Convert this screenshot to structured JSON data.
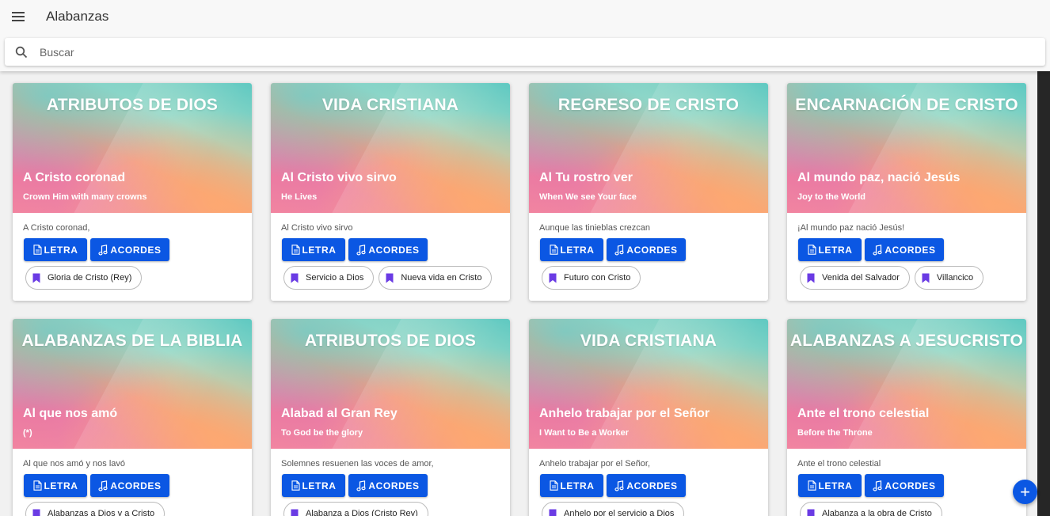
{
  "app": {
    "title": "Alabanzas"
  },
  "search": {
    "placeholder": "Buscar"
  },
  "colors": {
    "primary": "#0b57e3"
  },
  "buttons": {
    "letra": "LETRA",
    "acordes": "ACORDES"
  },
  "cards": [
    {
      "category": "ATRIBUTOS DE DIOS",
      "title": "A Cristo coronad",
      "subtitle": "Crown Him with many crowns",
      "first_line": "A Cristo coronad,",
      "tags": [
        "Gloria de Cristo (Rey)"
      ]
    },
    {
      "category": "VIDA CRISTIANA",
      "title": "Al Cristo vivo sirvo",
      "subtitle": "He Lives",
      "first_line": "Al Cristo vivo sirvo",
      "tags": [
        "Servicio a Dios",
        "Nueva vida en Cristo"
      ]
    },
    {
      "category": "REGRESO DE CRISTO",
      "title": "Al Tu rostro ver",
      "subtitle": "When We see Your face",
      "first_line": "Aunque las tinieblas crezcan",
      "tags": [
        "Futuro con Cristo"
      ]
    },
    {
      "category": "ENCARNACIÓN DE CRISTO",
      "title": "Al mundo paz, nació Jesús",
      "subtitle": "Joy to the World",
      "first_line": "¡Al mundo paz nació Jesús!",
      "tags": [
        "Venida del Salvador",
        "Villancico"
      ]
    },
    {
      "category": "ALABANZAS DE LA BIBLIA",
      "title": "Al que nos amó",
      "subtitle": "(*)",
      "first_line": "Al que nos amó y nos lavó",
      "tags": [
        "Alabanzas a Dios y a Cristo"
      ]
    },
    {
      "category": "ATRIBUTOS DE DIOS",
      "title": "Alabad al Gran Rey",
      "subtitle": "To God be the glory",
      "first_line": "Solemnes resuenen las voces de amor,",
      "tags": [
        "Alabanza a Dios (Cristo Rey)"
      ]
    },
    {
      "category": "VIDA CRISTIANA",
      "title": "Anhelo trabajar por el Señor",
      "subtitle": "I Want to Be a Worker",
      "first_line": "Anhelo trabajar por el Señor,",
      "tags": [
        "Anhelo por el servicio a Dios"
      ]
    },
    {
      "category": "ALABANZAS A JESUCRISTO",
      "title": "Ante el trono celestial",
      "subtitle": "Before the Throne",
      "first_line": "Ante el trono celestial",
      "tags": [
        "Alabanza a la obra de Cristo"
      ]
    }
  ],
  "fab": {
    "icon": "plus-icon",
    "label": "+"
  }
}
